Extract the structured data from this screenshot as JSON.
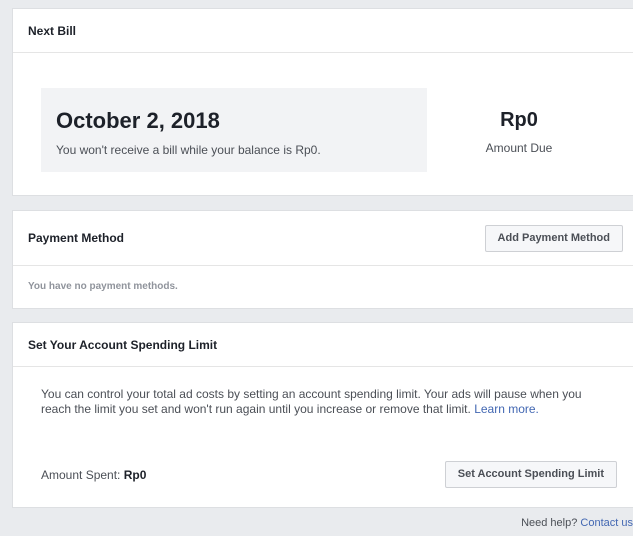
{
  "next_bill": {
    "title": "Next Bill",
    "date": "October 2, 2018",
    "note": "You won't receive a bill while your balance is Rp0.",
    "amount_value": "Rp0",
    "amount_label": "Amount Due"
  },
  "payment_method": {
    "title": "Payment Method",
    "add_button": "Add Payment Method",
    "empty_text": "You have no payment methods."
  },
  "spending_limit": {
    "title": "Set Your Account Spending Limit",
    "description": "You can control your total ad costs by setting an account spending limit. Your ads will pause when you reach the limit you set and won't run again until you increase or remove that limit.",
    "learn_more": "Learn more.",
    "amount_spent_label": "Amount Spent:",
    "amount_spent_value": "Rp0",
    "set_button": "Set Account Spending Limit"
  },
  "help": {
    "prefix": "Need help?",
    "link": "Contact us"
  },
  "colors": {
    "background": "#e9ebee",
    "link": "#4267b2",
    "button_bg": "#f6f7f9"
  }
}
